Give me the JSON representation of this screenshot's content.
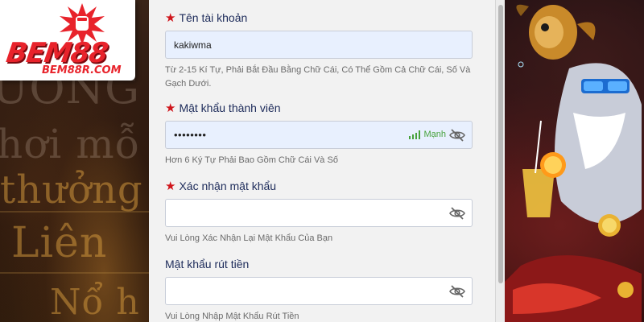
{
  "logo": {
    "brand": "BEM88",
    "domain": "BEM88R.COM"
  },
  "background_words": [
    "ƯƠNG",
    "hơi mỗ",
    "thưởng",
    "Liên",
    "Nổ h"
  ],
  "form": {
    "username": {
      "label": "Tên tài khoản",
      "required": true,
      "value": "kakiwma",
      "hint": "Từ 2-15 Kí Tự, Phải Bắt Đầu Bằng Chữ Cái, Có Thể Gồm Cả Chữ Cái, Số Và Gạch Dưới."
    },
    "password": {
      "label": "Mật khẩu thành viên",
      "required": true,
      "value": "••••••••",
      "strength": "Mạnh",
      "hint": "Hơn 6 Ký Tự Phải Bao Gồm Chữ Cái Và Số"
    },
    "confirm_password": {
      "label": "Xác nhận mật khẩu",
      "required": true,
      "value": "",
      "hint": "Vui Lòng Xác Nhận Lại Mật Khẩu Của Bạn"
    },
    "withdraw_password": {
      "label": "Mật khẩu rút tiền",
      "required": false,
      "value": "",
      "hint": "Vui Lòng Nhập Mật Khẩu Rút Tiền"
    }
  },
  "icons": {
    "required": "star-icon",
    "visibility": "eye-slash-icon",
    "strength": "signal-bars-icon"
  },
  "colors": {
    "label": "#1d2b5a",
    "required_star": "#d0151b",
    "strength": "#46a23b",
    "filled_input": "#e8f0fe",
    "logo_red": "#e8232b"
  }
}
